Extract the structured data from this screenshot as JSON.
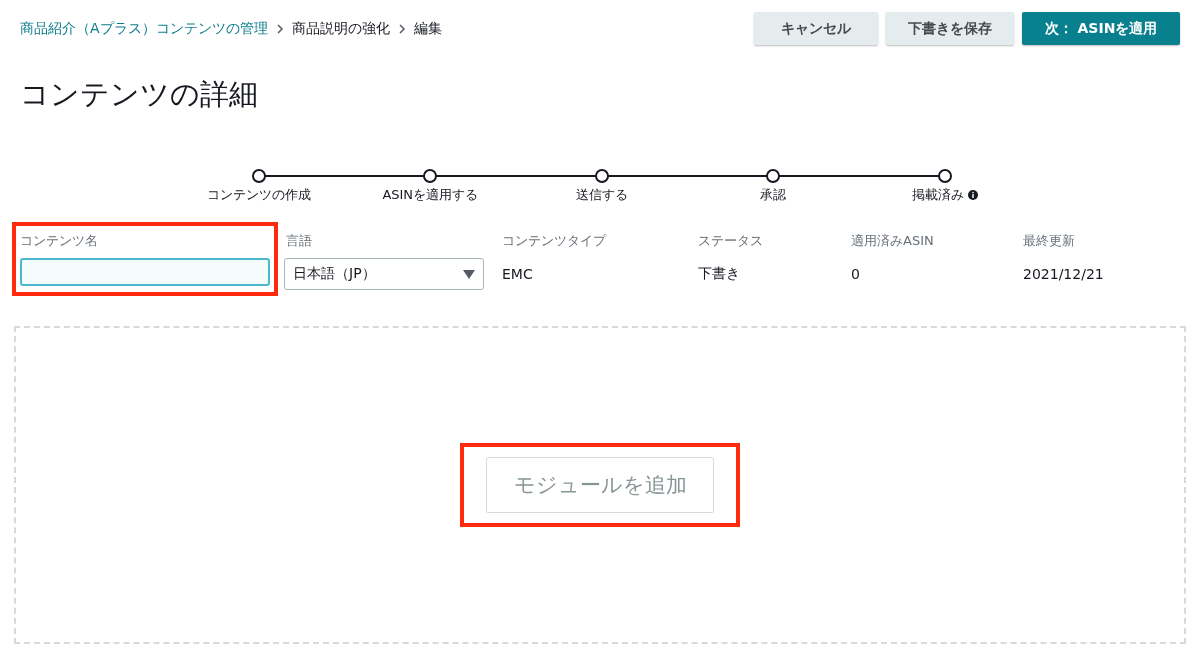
{
  "breadcrumb": [
    {
      "label": "商品紹介（Aプラス）コンテンツの管理",
      "link": true
    },
    {
      "label": "商品説明の強化",
      "link": false
    },
    {
      "label": "編集",
      "link": false
    }
  ],
  "buttons": [
    {
      "label": "キャンセル",
      "kind": "secondary"
    },
    {
      "label": "下書きを保存",
      "kind": "secondary"
    },
    {
      "label": "次： ASINを適用",
      "kind": "primary"
    }
  ],
  "title": "コンテンツの詳細",
  "steps": [
    {
      "label": "コンテンツの作成",
      "info_icon": false
    },
    {
      "label": "ASINを適用する",
      "info_icon": false
    },
    {
      "label": "送信する",
      "info_icon": false
    },
    {
      "label": "承認",
      "info_icon": false
    },
    {
      "label": "掲載済み",
      "info_icon": true
    }
  ],
  "details": [
    {
      "label": "コンテンツ名",
      "kind": "input",
      "highlighted": true
    },
    {
      "label": "言語",
      "kind": "select",
      "value": "日本語（JP）",
      "highlighted": false
    },
    {
      "label": "コンテンツタイプ",
      "kind": "text",
      "value": "EMC",
      "highlighted": false
    },
    {
      "label": "ステータス",
      "kind": "text",
      "value": "下書き",
      "highlighted": false
    },
    {
      "label": "適用済みASIN",
      "kind": "text",
      "value": "0",
      "highlighted": false
    },
    {
      "label": "最終更新",
      "kind": "text",
      "value": "2021/12/21",
      "highlighted": false
    }
  ],
  "module_area": {
    "button": "モジュールを追加",
    "highlighted": true
  }
}
